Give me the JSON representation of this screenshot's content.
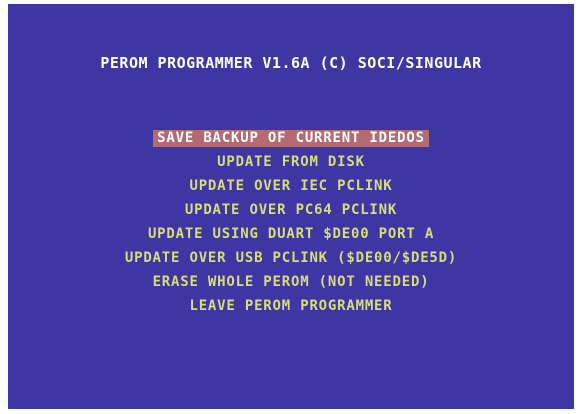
{
  "title": "PEROM PROGRAMMER V1.6A (C) SOCI/SINGULAR",
  "menu": {
    "items": [
      {
        "label": "SAVE BACKUP OF CURRENT IDEDOS",
        "selected": true
      },
      {
        "label": "UPDATE FROM DISK",
        "selected": false
      },
      {
        "label": "UPDATE OVER IEC PCLINK",
        "selected": false
      },
      {
        "label": "UPDATE OVER PC64 PCLINK",
        "selected": false
      },
      {
        "label": "UPDATE USING DUART $DE00 PORT A",
        "selected": false
      },
      {
        "label": "UPDATE OVER USB PCLINK ($DE00/$DE5D)",
        "selected": false
      },
      {
        "label": "ERASE WHOLE PEROM (NOT NEEDED)",
        "selected": false
      },
      {
        "label": "LEAVE PEROM PROGRAMMER",
        "selected": false
      }
    ]
  },
  "colors": {
    "screen_background": "#3d36a3",
    "title_text": "#ffffff",
    "menu_text": "#d8dc7c",
    "highlight_background": "#b46a72",
    "highlight_text": "#ffffff"
  }
}
